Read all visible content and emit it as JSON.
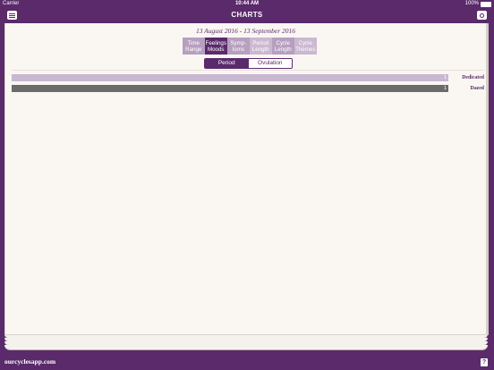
{
  "status_bar": {
    "carrier": "Carrier",
    "time": "10:44 AM",
    "battery": "100%"
  },
  "nav": {
    "title": "CHARTS",
    "left_icon": "menu-icon",
    "right_icon": "camera-icon"
  },
  "date_range": "13 August 2016 - 13 September 2016",
  "tabs": [
    {
      "line1": "Time",
      "line2": "Range"
    },
    {
      "line1": "Feelings",
      "line2": "Moods"
    },
    {
      "line1": "Symp-",
      "line2": "toms"
    },
    {
      "line1": "Period",
      "line2": "Length"
    },
    {
      "line1": "Cycle",
      "line2": "Length"
    },
    {
      "line1": "Cycle",
      "line2": "Themes"
    }
  ],
  "segment": {
    "left": "Period",
    "right": "Ovulation",
    "selected": "Period"
  },
  "chart_data": {
    "type": "bar",
    "orientation": "horizontal",
    "categories": [
      "Dedicated",
      "Dazed"
    ],
    "values": [
      1,
      1
    ],
    "colors": [
      "#c9b8d1",
      "#6b6b6b"
    ]
  },
  "footer": {
    "site": "ourcyclesapp.com",
    "help": "?"
  }
}
